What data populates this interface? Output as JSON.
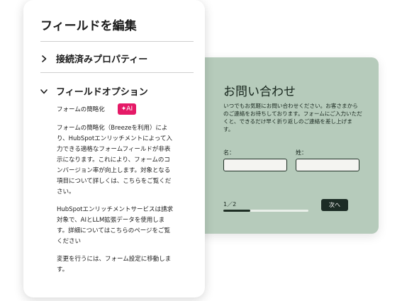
{
  "panel": {
    "title": "フィールドを編集",
    "sections": [
      {
        "label": "接続済みプロパティー",
        "expanded": false
      },
      {
        "label": "フィールドオプション",
        "expanded": true
      }
    ],
    "option_label": "フォームの簡略化",
    "ai_badge": "✦AI",
    "paragraphs": [
      "フォームの簡略化（Breezeを利用）により、HubSpotエンリッチメントによって入力できる適格なフォームフィールドが非表示になります。これにより、フォームのコンバージョン率が向上します。対象となる項目について詳しくは、こちらをご覧ください。",
      "HubSpotエンリッチメントサービスは請求対象で、AIとLLM拡張データを使用します。詳細についてはこちらのページをご覧ください",
      "変更を行うには、フォーム設定に移動します。"
    ]
  },
  "preview": {
    "title": "お問い合わせ",
    "description": "いつでもお気軽にお問い合わせください。お客さまからのご連絡をお待ちしております。フォームにご入力いただくと、できるだけ早く折り返しのご連絡を差し上げます。",
    "first_name_label": "名：",
    "last_name_label": "姓：",
    "step": "1／2",
    "progress": 0.32,
    "next_button": "次へ"
  },
  "colors": {
    "preview_bg": "#b6cbbb",
    "ai_badge": "#e51a67",
    "next_button": "#1c2c25"
  }
}
